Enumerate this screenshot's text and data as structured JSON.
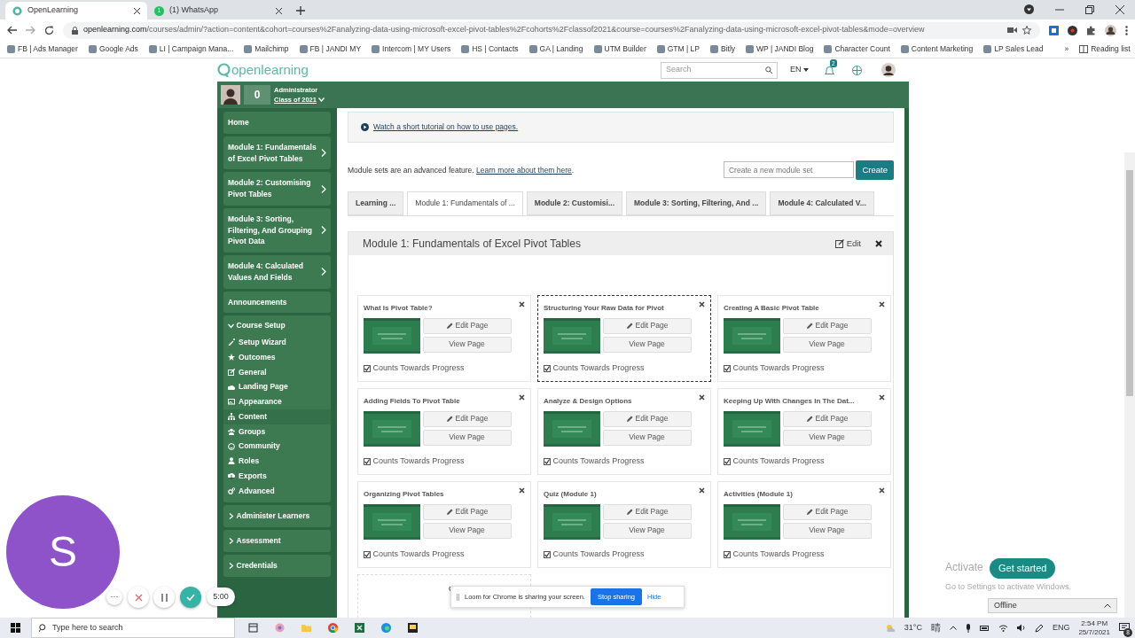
{
  "browser": {
    "tabs": [
      {
        "title": "OpenLearning",
        "selected": true
      },
      {
        "title": "(1) WhatsApp",
        "selected": false,
        "badge": "1"
      }
    ],
    "url_domain": "openlearning.com",
    "url_path": "/courses/admin/?action=content&cohort=courses%2Fanalyzing-data-using-microsoft-excel-pivot-tables%2Fcohorts%2Fclassof2021&course=courses%2Fanalyzing-data-using-microsoft-excel-pivot-tables&mode=overview",
    "bookmarks": [
      "FB | Ads Manager",
      "Google Ads",
      "LI | Campaign Mana...",
      "Mailchimp",
      "FB | JANDI MY",
      "Intercom | MY Users",
      "HS | Contacts",
      "GA | Landing",
      "UTM Builder",
      "GTM | LP",
      "Bitly",
      "WP | JANDI Blog",
      "Character Count",
      "Content Marketing",
      "LP Sales Lead"
    ],
    "more": "»",
    "reading_list": "Reading list"
  },
  "site": {
    "logo": "openlearning",
    "search_placeholder": "Search",
    "language": "EN",
    "notifications": "2"
  },
  "user": {
    "points": "0",
    "role": "Administrator",
    "cohort": "Class of 2021"
  },
  "sidebar": [
    {
      "kind": "link",
      "label": "Home"
    },
    {
      "kind": "module",
      "label": "Module 1: Fundamentals of Excel Pivot Tables"
    },
    {
      "kind": "module",
      "label": "Module 2: Customising Pivot Tables"
    },
    {
      "kind": "module",
      "label": "Module 3: Sorting, Filtering, And Grouping Pivot Data"
    },
    {
      "kind": "module",
      "label": "Module 4: Calculated Values And Fields"
    },
    {
      "kind": "link",
      "label": "Announcements"
    },
    {
      "kind": "section",
      "label": "Course Setup",
      "expanded": true,
      "children": [
        {
          "label": "Setup Wizard",
          "selected": false
        },
        {
          "label": "Outcomes",
          "selected": false
        },
        {
          "label": "General",
          "selected": false
        },
        {
          "label": "Landing Page",
          "selected": false
        },
        {
          "label": "Appearance",
          "selected": false
        },
        {
          "label": "Content",
          "selected": true
        },
        {
          "label": "Groups",
          "selected": false
        },
        {
          "label": "Community",
          "selected": false
        },
        {
          "label": "Roles",
          "selected": false
        },
        {
          "label": "Exports",
          "selected": false
        },
        {
          "label": "Advanced",
          "selected": false
        }
      ]
    },
    {
      "kind": "section",
      "label": "Administer Learners",
      "expanded": false
    },
    {
      "kind": "section",
      "label": "Assessment",
      "expanded": false
    },
    {
      "kind": "section",
      "label": "Credentials",
      "expanded": false
    }
  ],
  "main": {
    "tutorial_link": "Watch a short tutorial on how to use pages.",
    "note": "Module sets are an advanced feature. ",
    "note_link": "Learn more about them here",
    "note_end": ".",
    "module_set_placeholder": "Create a new module set",
    "create_button": "Create",
    "module_tabs": [
      {
        "label": "Learning ...",
        "selected": false
      },
      {
        "label": "Module 1: Fundamentals of ...",
        "selected": true
      },
      {
        "label": "Module 2: Customisi...",
        "selected": false
      },
      {
        "label": "Module 3: Sorting, Filtering, And ...",
        "selected": false
      },
      {
        "label": "Module 4: Calculated V...",
        "selected": false
      }
    ],
    "panel": {
      "title": "Module 1: Fundamentals of Excel Pivot Tables",
      "edit": "Edit",
      "pages": [
        {
          "title": "What Is Pivot Table?",
          "selected": false,
          "counts": true,
          "edit_page": "Edit Page",
          "view_page": "View Page",
          "counts_label": "Counts Towards Progress"
        },
        {
          "title": "Structuring Your Raw Data for Pivot",
          "selected": true,
          "counts": true,
          "edit_page": "Edit Page",
          "view_page": "View Page",
          "counts_label": "Counts Towards Progress"
        },
        {
          "title": "Creating A Basic Pivot Table",
          "selected": false,
          "counts": true,
          "edit_page": "Edit Page",
          "view_page": "View Page",
          "counts_label": "Counts Towards Progress"
        },
        {
          "title": "Adding Fields To Pivot Table",
          "selected": false,
          "counts": true,
          "edit_page": "Edit Page",
          "view_page": "View Page",
          "counts_label": "Counts Towards Progress"
        },
        {
          "title": "Analyze & Design Options",
          "selected": false,
          "counts": true,
          "edit_page": "Edit Page",
          "view_page": "View Page",
          "counts_label": "Counts Towards Progress"
        },
        {
          "title": "Keeping Up With Changes In The Dat...",
          "selected": false,
          "counts": true,
          "edit_page": "Edit Page",
          "view_page": "View Page",
          "counts_label": "Counts Towards Progress"
        },
        {
          "title": "Organizing Pivot Tables",
          "selected": false,
          "counts": true,
          "edit_page": "Edit Page",
          "view_page": "View Page",
          "counts_label": "Counts Towards Progress"
        },
        {
          "title": "Quiz (Module 1)",
          "selected": false,
          "counts": true,
          "edit_page": "Edit Page",
          "view_page": "View Page",
          "counts_label": "Counts Towards Progress"
        },
        {
          "title": "Activities (Module 1)",
          "selected": false,
          "counts": true,
          "edit_page": "Edit Page",
          "view_page": "View Page",
          "counts_label": "Counts Towards Progress"
        }
      ]
    }
  },
  "overlays": {
    "bubble_letter": "S",
    "more": "···",
    "timer": "5:00",
    "share_text": "Loom for Chrome is sharing your screen.",
    "stop_sharing": "Stop sharing",
    "hide": "Hide",
    "get_started": "Get started",
    "activate_title": "Activate",
    "activate_text": "Go to Settings to activate Windows.",
    "chat_status": "Offline"
  },
  "taskbar": {
    "search_placeholder": "Type here to search",
    "temperature": "31°C",
    "weather": "晴",
    "language": "ENG",
    "time": "2:54 PM",
    "date": "25/7/2021",
    "notifications": "8"
  }
}
